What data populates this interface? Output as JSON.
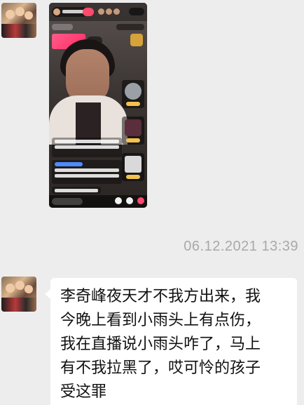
{
  "messages": {
    "timestamp": "06.12.2021 13:39",
    "text_lines": [
      "李奇峰夜天才不我方出来，我",
      "今晚上看到小雨头上有点伤，",
      "我在直播说小雨头咋了，马上",
      "有不我拉黑了，哎可怜的孩子",
      "受这罪"
    ]
  },
  "colors": {
    "chat_background": "#ededed",
    "bubble_background": "#ffffff",
    "timestamp_text": "#a9a9a9"
  },
  "icons": {
    "sender_avatar": "avatar-image",
    "image_message": "live-stream-screenshot"
  }
}
